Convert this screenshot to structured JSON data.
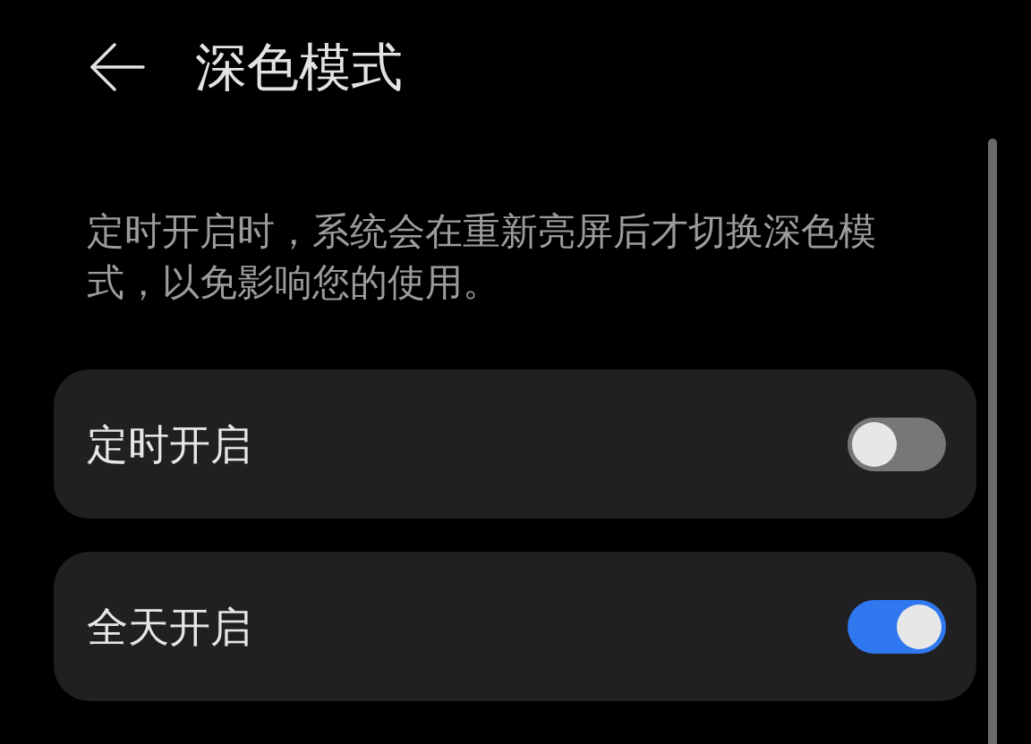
{
  "header": {
    "title": "深色模式"
  },
  "description": "定时开启时，系统会在重新亮屏后才切换深色模式，以免影响您的使用。",
  "settings": [
    {
      "label": "定时开启",
      "on": false
    },
    {
      "label": "全天开启",
      "on": true
    }
  ]
}
